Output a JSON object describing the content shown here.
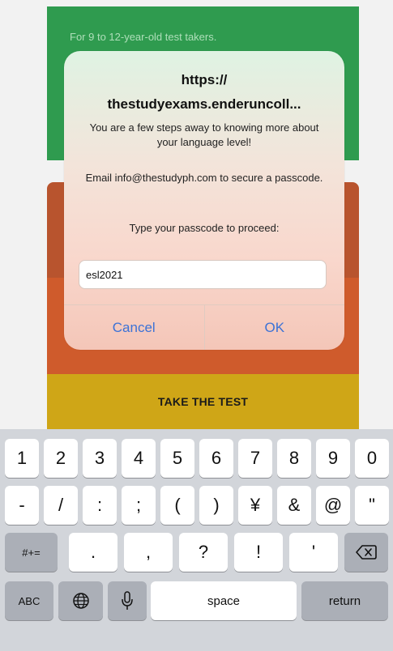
{
  "background": {
    "green_card_text": "For 9 to 12-year-old test takers.",
    "cta_label": "TAKE THE TEST"
  },
  "dialog": {
    "title_line1": "https://",
    "title_line2": "thestudyexams.enderuncoll...",
    "message1": "You are a few steps away to knowing more about your language level!",
    "message2": "Email info@thestudyph.com to secure a passcode.",
    "message3": "Type your passcode to proceed:",
    "input_value": "esl2021",
    "cancel_label": "Cancel",
    "ok_label": "OK"
  },
  "keyboard": {
    "row1": [
      "1",
      "2",
      "3",
      "4",
      "5",
      "6",
      "7",
      "8",
      "9",
      "0"
    ],
    "row2": [
      "-",
      "/",
      ":",
      ";",
      "(",
      ")",
      "¥",
      "&",
      "@",
      "\""
    ],
    "row3": {
      "mode_key": "#+=",
      "keys": [
        ".",
        ",",
        "?",
        "!",
        "'"
      ],
      "delete_icon": "delete-icon"
    },
    "row4": {
      "abc_label": "ABC",
      "globe_icon": "globe-icon",
      "mic_icon": "microphone-icon",
      "space_label": "space",
      "return_label": "return"
    }
  },
  "colors": {
    "green": "#2f9b4f",
    "orange": "#cf5b2c",
    "yellow": "#cfa617",
    "ios_blue": "#3c72d6"
  }
}
